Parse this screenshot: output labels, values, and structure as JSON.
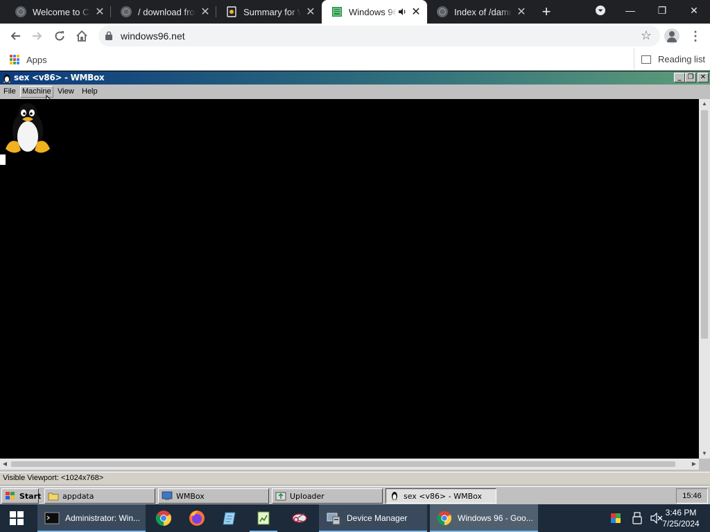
{
  "browser": {
    "tabs": [
      {
        "title": "Welcome to Chr"
      },
      {
        "title": "/ download from"
      },
      {
        "title": "Summary for W"
      },
      {
        "title": "Windows 96"
      },
      {
        "title": "Index of /damn"
      }
    ],
    "new_tab": "+",
    "window_controls": {
      "minimize": "—",
      "restore": "❐",
      "close": "✕"
    },
    "url": "windows96.net",
    "bookmarks": {
      "apps": "Apps",
      "reading_list": "Reading list"
    }
  },
  "wmbox": {
    "title": "sex <v86> - WMBox",
    "menu": [
      "File",
      "Machine",
      "View",
      "Help"
    ],
    "status": "Visible Viewport: <1024x768>"
  },
  "w96_taskbar": {
    "start": "Start",
    "items": [
      "appdata",
      "WMBox",
      "Uploader",
      "sex <v86> - WMBox"
    ],
    "clock": "15:46"
  },
  "taskbar": {
    "items": {
      "terminal": "Administrator: Win...",
      "device_manager": "Device Manager",
      "chrome": "Windows 96 - Goo..."
    },
    "time": "3:46 PM",
    "date": "7/25/2024"
  },
  "colors": {
    "accent": "#76b9ed",
    "tab_active": "#ffffff",
    "tabstrip": "#202124",
    "wmbox_title_start": "#0c3a7d",
    "wmbox_title_end": "#5e9c7a"
  }
}
